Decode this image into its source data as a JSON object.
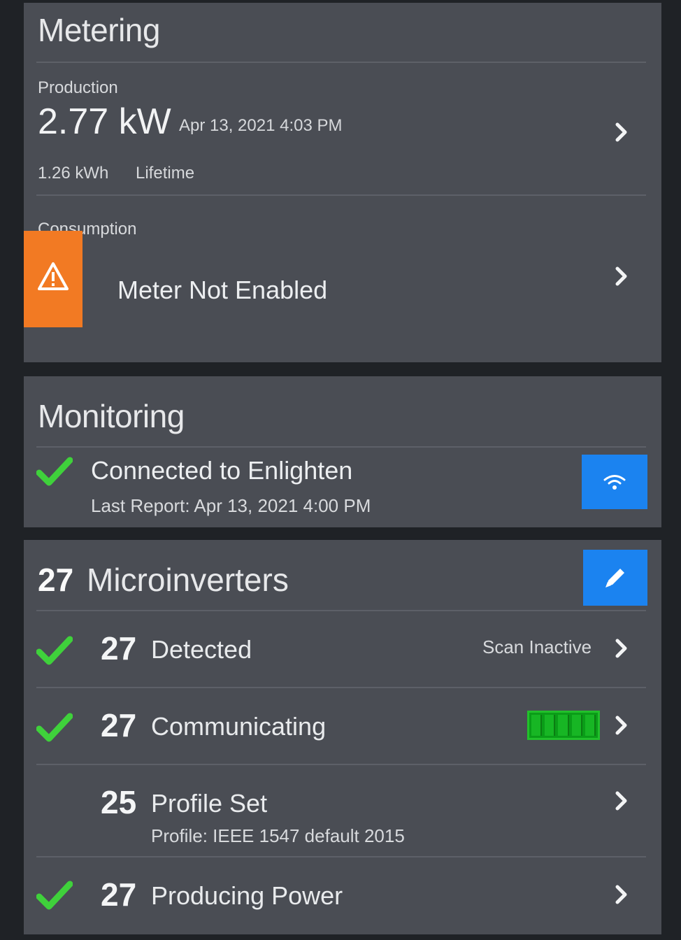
{
  "metering": {
    "title": "Metering",
    "production": {
      "label": "Production",
      "value": "2.77 kW",
      "timestamp": "Apr 13, 2021 4:03 PM",
      "lifetime_value": "1.26 kWh",
      "lifetime_label": "Lifetime"
    },
    "consumption": {
      "label": "Consumption",
      "status": "Meter Not Enabled",
      "warning_icon": "warning-triangle-icon"
    }
  },
  "monitoring": {
    "title": "Monitoring",
    "status": "Connected to Enlighten",
    "last_report": "Last Report: Apr 13, 2021 4:00 PM",
    "button_icon": "wifi-icon"
  },
  "microinverters": {
    "count": "27",
    "title": "Microinverters",
    "edit_icon": "pencil-icon",
    "rows": [
      {
        "count": "27",
        "label": "Detected",
        "checked": true,
        "status": "Scan Inactive"
      },
      {
        "count": "27",
        "label": "Communicating",
        "checked": true,
        "signal_level": 5,
        "signal_max": 5
      },
      {
        "count": "25",
        "label": "Profile Set",
        "checked": false,
        "detail": "Profile: IEEE 1547 default 2015"
      },
      {
        "count": "27",
        "label": "Producing Power",
        "checked": true
      }
    ]
  },
  "colors": {
    "panel": "#4a4d54",
    "background": "#1f2226",
    "warning": "#f27a23",
    "accent_blue": "#1b83f0",
    "check_green": "#3fd13b"
  }
}
